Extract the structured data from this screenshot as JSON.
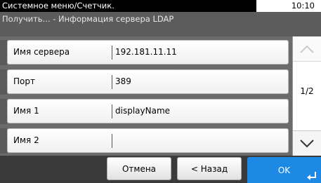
{
  "header": {
    "title": "Системное меню/Счетчик.",
    "time": "10:10",
    "subtitle": "Получить... - Информация сервера LDAP"
  },
  "rows": [
    {
      "label": "Имя сервера",
      "value": "192.181.11.11"
    },
    {
      "label": "Порт",
      "value": "389"
    },
    {
      "label": "Имя 1",
      "value": "displayName"
    },
    {
      "label": "Имя 2",
      "value": ""
    }
  ],
  "scroll": {
    "page": "1/2",
    "up_icon": "chevron-up-icon",
    "down_icon": "chevron-down-icon",
    "up_enabled": false
  },
  "footer": {
    "cancel_label": "Отмена",
    "back_label": "< Назад",
    "ok_label": "OK",
    "enter_icon": "enter-icon"
  },
  "colors": {
    "title_bg": "#000000",
    "subbar_bg": "#5c5c5c",
    "content_bg": "#6b6b6b",
    "footer_bg": "#3a3a3a",
    "ok_bg": "#1e88e5"
  }
}
